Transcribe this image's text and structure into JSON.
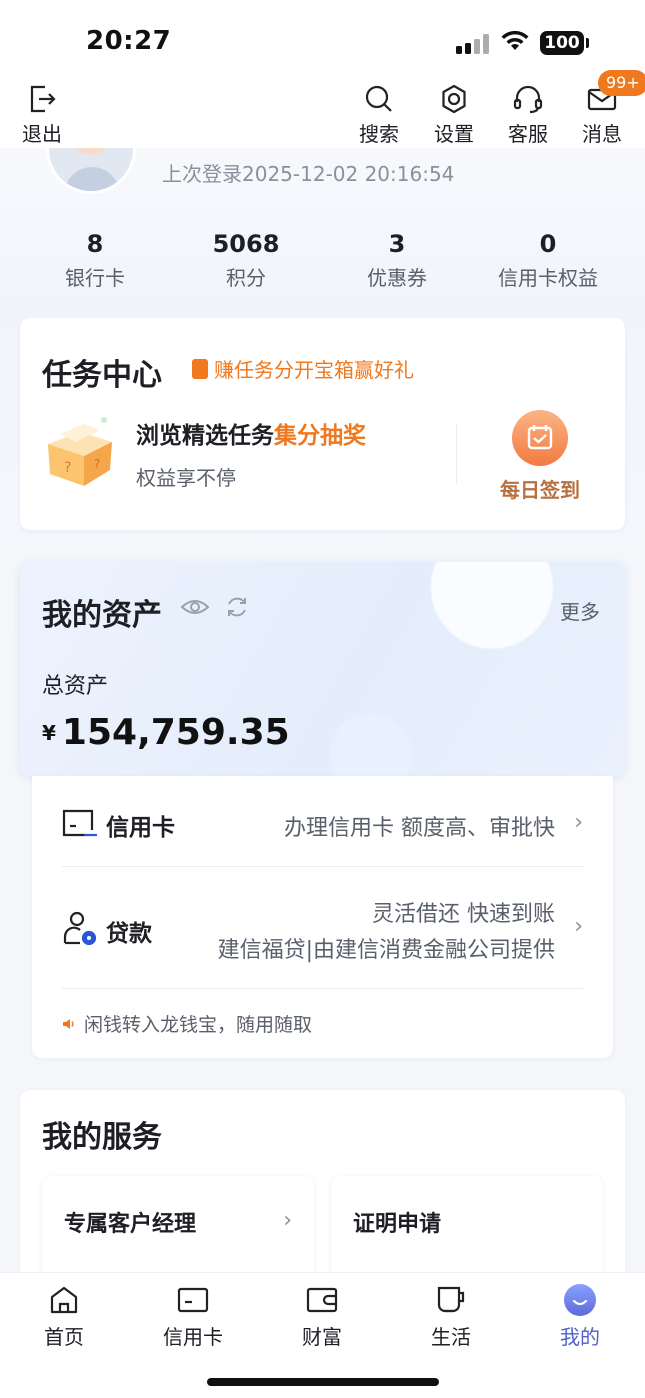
{
  "status_bar": {
    "time": "20:27",
    "battery": "100"
  },
  "top_nav": {
    "logout": "退出",
    "search": "搜索",
    "settings": "设置",
    "service": "客服",
    "messages": "消息",
    "message_badge": "99+"
  },
  "profile": {
    "last_login": "上次登录2025-12-02 20:16:54"
  },
  "stats": [
    {
      "value": "8",
      "label": "银行卡"
    },
    {
      "value": "5068",
      "label": "积分"
    },
    {
      "value": "3",
      "label": "优惠券"
    },
    {
      "value": "0",
      "label": "信用卡权益"
    }
  ],
  "task_center": {
    "title": "任务中心",
    "promo": "赚任务分开宝箱赢好礼",
    "line1_prefix": "浏览精选任务",
    "line1_highlight": "集分抽奖",
    "line2": "权益享不停",
    "signin": "每日签到",
    "accent": "#f0781e"
  },
  "assets": {
    "title": "我的资产",
    "more": "更多",
    "total_label": "总资产",
    "currency": "¥",
    "total_amount": "154,759.35"
  },
  "products": {
    "credit_card": {
      "name": "信用卡",
      "desc": "办理信用卡 额度高、审批快"
    },
    "loan": {
      "name": "贷款",
      "desc1": "灵活借还 快速到账",
      "desc2": "建信福贷|由建信消费金融公司提供"
    },
    "tip": "闲钱转入龙钱宝，随用随取"
  },
  "services": {
    "title": "我的服务",
    "items": [
      {
        "label": "专属客户经理"
      },
      {
        "label": "证明申请"
      }
    ]
  },
  "tabs": [
    {
      "label": "首页",
      "icon": "home-icon"
    },
    {
      "label": "信用卡",
      "icon": "card-icon"
    },
    {
      "label": "财富",
      "icon": "wallet-icon"
    },
    {
      "label": "生活",
      "icon": "cup-icon"
    },
    {
      "label": "我的",
      "icon": "profile-icon",
      "active": true
    }
  ],
  "colors": {
    "active_tab": "#4f61c8",
    "accent": "#f0781e"
  }
}
